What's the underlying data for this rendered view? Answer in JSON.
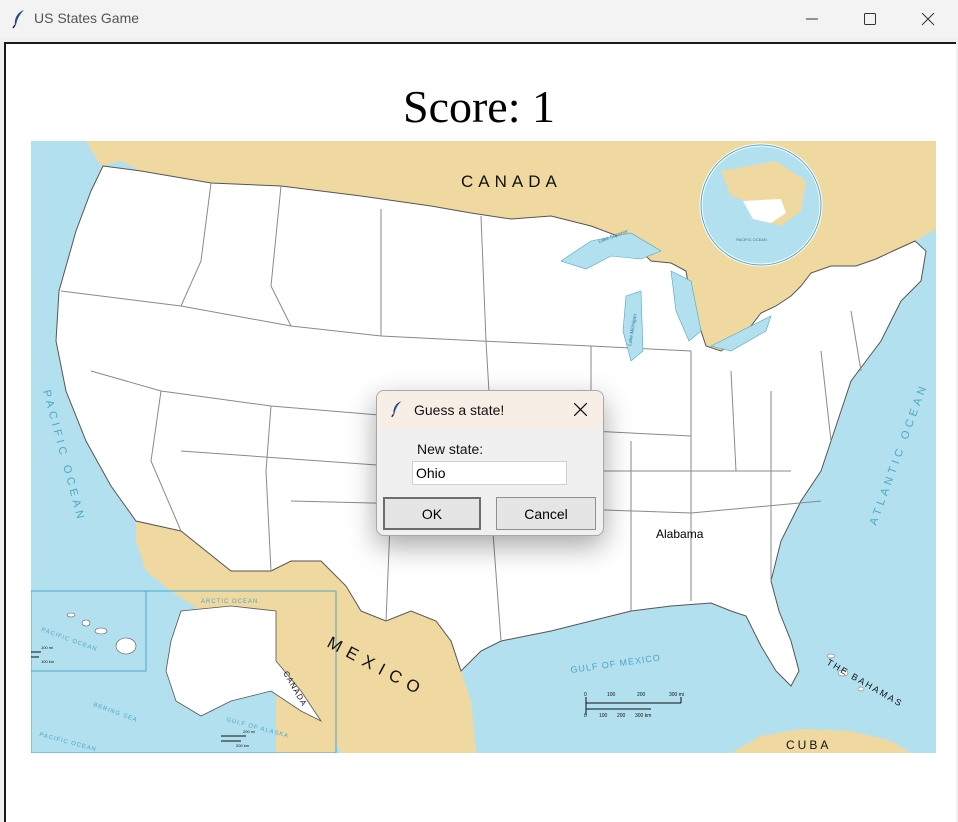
{
  "window": {
    "title": "US States Game",
    "controls": [
      "minimize-icon",
      "maximize-icon",
      "close-icon"
    ]
  },
  "score_text": "Score: 1",
  "map": {
    "labels": {
      "canada": "CANADA",
      "mexico": "MEXICO",
      "pacific_ocean": "PACIFIC OCEAN",
      "atlantic_ocean": "ATLANTIC OCEAN",
      "gulf_of_mexico": "GULF OF MEXICO",
      "bahamas": "THE BAHAMAS",
      "cuba": "CUBA",
      "guessed_state": "Alabama",
      "inset_canada": "CANADA",
      "inset_arctic": "ARCTIC OCEAN",
      "inset_pacific_hawaii": "PACIFIC OCEAN",
      "inset_pacific_alaska": "PACIFIC OCEAN",
      "bering_sea": "BERING SEA",
      "gulf_of_alaska": "GULF OF ALASKA",
      "lake_superior": "Lake Superior",
      "lake_michigan": "Lake Michigan",
      "pacific_ocean_globe": "PACIFIC OCEAN"
    },
    "scale": {
      "main_miles": [
        "0",
        "100",
        "200",
        "300 mi"
      ],
      "main_km": [
        "0",
        "100",
        "200",
        "300 km"
      ],
      "hawaii_mi": "100 mi",
      "hawaii_km": "100 km",
      "alaska_mi": "200 mi",
      "alaska_km": "200 km"
    },
    "colors": {
      "water": "#b3e0ee",
      "foreign_land": "#f0d9a0",
      "us_land": "#ffffff",
      "ocean_label": "#4aa8c8"
    }
  },
  "dialog": {
    "title": "Guess a state!",
    "prompt": "New state:",
    "input_value": "Ohio",
    "ok_label": "OK",
    "cancel_label": "Cancel"
  }
}
